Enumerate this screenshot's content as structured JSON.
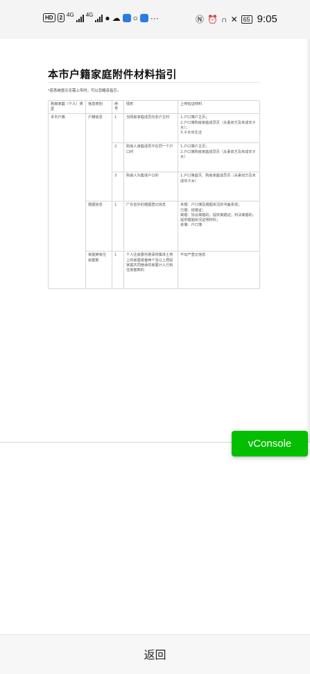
{
  "status_bar": {
    "left_badges": [
      "HD",
      "2"
    ],
    "signal_labels": [
      "4G",
      "4G"
    ],
    "icons_left": [
      "wechat-icon",
      "weather-icon",
      "app-icon",
      "cloud-icon",
      "app-blue-icon",
      "more-icon"
    ],
    "more": "···",
    "icons_right": [
      "nfc-icon",
      "alarm-icon",
      "headset-icon",
      "mute-icon"
    ],
    "battery": "65",
    "time": "9:05"
  },
  "document": {
    "title": "本市户籍家庭附件材料指引",
    "note": "*若系统提示无需上传时，可以忽略该指引。",
    "table": {
      "headers": [
        "购房家庭（个人）类型",
        "信息类别",
        "序号",
        "情形",
        "上传佐证材料"
      ],
      "rows": [
        {
          "type": "本市户籍",
          "category": "户籍信息",
          "no": "1",
          "situation": "当购房家庭成员均非户主时",
          "materials": [
            "1.户口簿户主页；",
            "2.户口簿购房家庭成员页（夫妻双方及未成年子女）；",
            "3.子女出生证"
          ]
        },
        {
          "type": "",
          "category": "",
          "no": "2",
          "situation": "购房人家庭成员不在同一个户口时",
          "materials": [
            "1.户口簿户主页；",
            "2.户口簿购房家庭成员页（夫妻双方及未成年子女）"
          ]
        },
        {
          "type": "",
          "category": "",
          "no": "3",
          "situation": "购房人为集体户口的",
          "materials": [
            "1.户口簿首页、购房家庭成员页（夫妻双方及未成年子女）"
          ]
        },
        {
          "type": "",
          "category": "婚姻信息",
          "no": "1",
          "situation": "广东省外的婚姻登记信息",
          "materials": [
            "未婚：户口簿及婚姻状况的书面承诺；",
            "已婚：结婚证；",
            "离婚：协议离婚的，提供离婚证；判决离婚的，提供婚姻状况证明材料；",
            "丧偶：户口簿"
          ]
        },
        {
          "type": "",
          "category": "家庭拥有住房套数",
          "no": "1",
          "situation": "个人住房委托继承将集体土地上的房屋或者两个及以上居民家庭共同继承的房屋计入已有住房套数的",
          "materials": [
            "不动产登记信息"
          ]
        }
      ]
    }
  },
  "vconsole_label": "vConsole",
  "back_label": "返回"
}
